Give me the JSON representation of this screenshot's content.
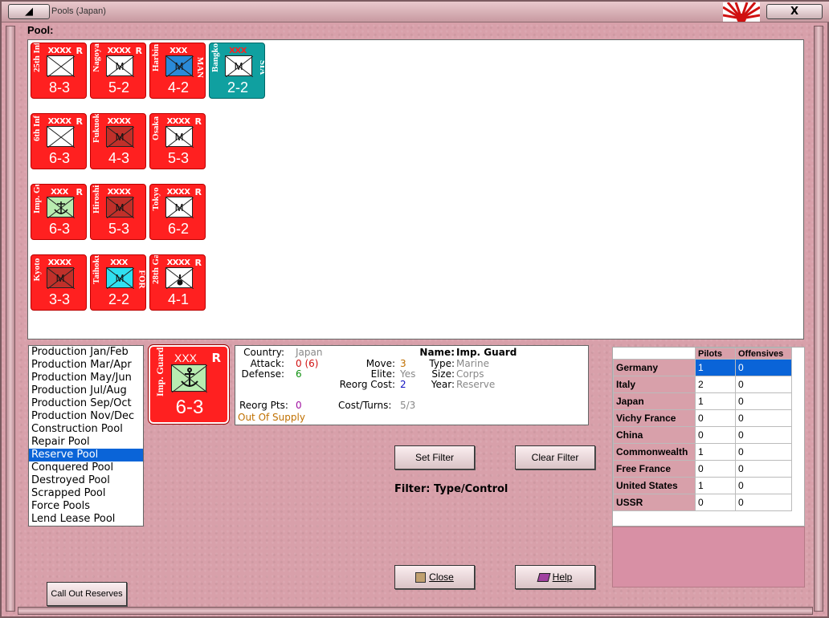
{
  "window": {
    "title": "Pools (Japan)",
    "min_glyph": "◢",
    "close_glyph": "X"
  },
  "pool_label": "Pool:",
  "counters": [
    {
      "name": "25th Inf",
      "size": "XXXX",
      "reserve": "R",
      "strength": "8-3",
      "symbol": "infantry",
      "box": "#ffffff",
      "bg": "red",
      "right": ""
    },
    {
      "name": "Nagoya",
      "size": "XXXX",
      "reserve": "R",
      "strength": "5-2",
      "symbol": "marine",
      "box": "#ffffff",
      "bg": "red",
      "right": ""
    },
    {
      "name": "Harbin",
      "size": "XXX",
      "reserve": "",
      "strength": "4-2",
      "symbol": "marine",
      "box": "#2a8ad8",
      "bg": "red",
      "right": "MAN"
    },
    {
      "name": "Bangkok",
      "size": "XXX",
      "reserve": "",
      "strength": "2-2",
      "symbol": "marine",
      "box": "#ffffff",
      "bg": "teal",
      "right": "SIA"
    },
    {
      "name": "6th Inf",
      "size": "XXXX",
      "reserve": "R",
      "strength": "6-3",
      "symbol": "infantry",
      "box": "#ffffff",
      "bg": "red",
      "right": ""
    },
    {
      "name": "Fukuoka",
      "size": "XXXX",
      "reserve": "",
      "strength": "4-3",
      "symbol": "marine",
      "box": "#c0302a",
      "bg": "red",
      "right": ""
    },
    {
      "name": "Osaka",
      "size": "XXXX",
      "reserve": "R",
      "strength": "5-3",
      "symbol": "marine",
      "box": "#ffffff",
      "bg": "red",
      "right": ""
    },
    {
      "name": "Imp. Guard",
      "size": "XXX",
      "reserve": "R",
      "strength": "6-3",
      "symbol": "anchor",
      "box": "#b8ecb0",
      "bg": "red",
      "right": ""
    },
    {
      "name": "Hiroshima",
      "size": "XXXX",
      "reserve": "",
      "strength": "5-3",
      "symbol": "marine",
      "box": "#c0302a",
      "bg": "red",
      "right": ""
    },
    {
      "name": "Tokyo",
      "size": "XXXX",
      "reserve": "R",
      "strength": "6-2",
      "symbol": "marine",
      "box": "#ffffff",
      "bg": "red",
      "right": ""
    },
    {
      "name": "Kyoto",
      "size": "XXXX",
      "reserve": "",
      "strength": "3-3",
      "symbol": "marine",
      "box": "#c0302a",
      "bg": "red",
      "right": ""
    },
    {
      "name": "Taihoku",
      "size": "XXX",
      "reserve": "",
      "strength": "2-2",
      "symbol": "marine",
      "box": "#30e0f0",
      "bg": "red",
      "right": "FOR"
    },
    {
      "name": "28th Garr",
      "size": "XXXX",
      "reserve": "R",
      "strength": "4-1",
      "symbol": "garrison",
      "box": "#ffffff",
      "bg": "red",
      "right": ""
    }
  ],
  "marine_letter": "M",
  "pool_list": [
    "Production Jan/Feb",
    "Production Mar/Apr",
    "Production May/Jun",
    "Production Jul/Aug",
    "Production Sep/Oct",
    "Production Nov/Dec",
    "Construction Pool",
    "Repair Pool",
    "Reserve Pool",
    "Conquered Pool",
    "Destroyed Pool",
    "Scrapped Pool",
    "Force Pools",
    "Lend Lease Pool"
  ],
  "pool_list_selected": "Reserve Pool",
  "selected": {
    "size": "XXX",
    "reserve": "R",
    "name": "Imp. Guard",
    "strength": "6-3"
  },
  "info": {
    "country_label": "Country:",
    "country": "Japan",
    "attack_label": "Attack:",
    "attack": "0 (6)",
    "defense_label": "Defense:",
    "defense": "6",
    "move_label": "Move:",
    "move": "3",
    "elite_label": "Elite:",
    "elite": "Yes",
    "reorg_cost_label": "Reorg Cost:",
    "reorg_cost": "2",
    "name_label": "Name:",
    "name": "Imp. Guard",
    "type_label": "Type:",
    "type": "Marine",
    "size_label": "Size:",
    "size": "Corps",
    "year_label": "Year:",
    "year": "Reserve",
    "reorg_pts_label": "Reorg Pts:",
    "reorg_pts": "0",
    "cost_turns_label": "Cost/Turns:",
    "cost_turns": "5/3",
    "supply": "Out Of Supply"
  },
  "buttons": {
    "set_filter": "Set Filter",
    "clear_filter": "Clear Filter",
    "close": "Close",
    "help": "Help",
    "call_out_reserves": "Call Out Reserves"
  },
  "filter_label": "Filter: Type/Control",
  "table": {
    "headers": [
      "",
      "Pilots",
      "Offensives"
    ],
    "rows": [
      {
        "country": "Germany",
        "pilots": "1",
        "offensives": "0"
      },
      {
        "country": "Italy",
        "pilots": "2",
        "offensives": "0"
      },
      {
        "country": "Japan",
        "pilots": "1",
        "offensives": "0"
      },
      {
        "country": "Vichy France",
        "pilots": "0",
        "offensives": "0"
      },
      {
        "country": "China",
        "pilots": "0",
        "offensives": "0"
      },
      {
        "country": "Commonwealth",
        "pilots": "1",
        "offensives": "0"
      },
      {
        "country": "Free France",
        "pilots": "0",
        "offensives": "0"
      },
      {
        "country": "United States",
        "pilots": "1",
        "offensives": "0"
      },
      {
        "country": "USSR",
        "pilots": "0",
        "offensives": "0"
      }
    ],
    "selected": "Germany"
  }
}
